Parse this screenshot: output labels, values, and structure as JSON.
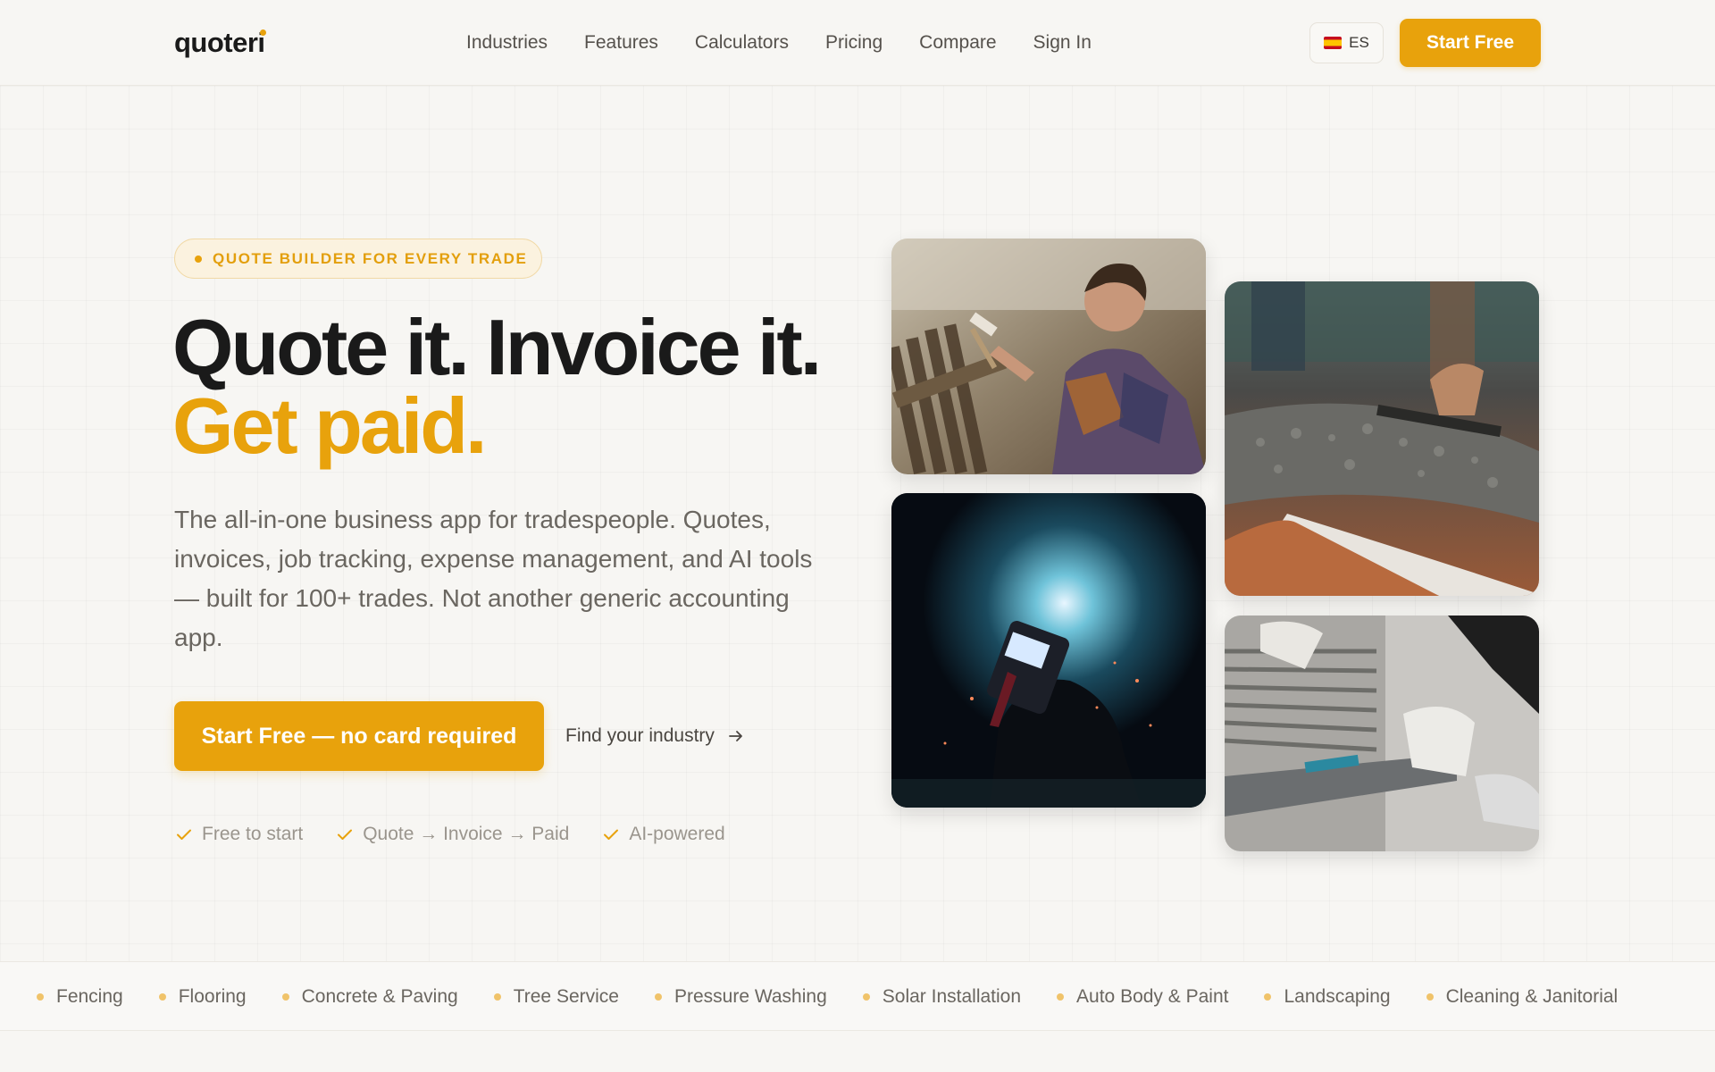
{
  "brand": {
    "name": "quoteri",
    "accent": "#e8a20c"
  },
  "nav": {
    "links": [
      "Industries",
      "Features",
      "Calculators",
      "Pricing",
      "Compare",
      "Sign In"
    ],
    "language": "ES",
    "cta": "Start Free"
  },
  "hero": {
    "badge": "QUOTE BUILDER FOR EVERY TRADE",
    "headline_line1": "Quote it. Invoice it.",
    "headline_line2": "Get paid.",
    "description": "The all-in-one business app for tradespeople. Quotes, invoices, job tracking, expense management, and AI tools — built for 100+ trades. Not another generic accounting app.",
    "primary_cta": "Start Free — no card required",
    "secondary_cta": "Find your industry",
    "checks": [
      "Free to start",
      "Quote → Invoice → Paid",
      "AI-powered"
    ]
  },
  "photos": [
    {
      "name": "carpenter-photo",
      "icon": "hammer-fence"
    },
    {
      "name": "concrete-photo",
      "icon": "concrete-screed"
    },
    {
      "name": "welder-photo",
      "icon": "welding-sparks"
    },
    {
      "name": "tiling-photo",
      "icon": "tile-floor"
    }
  ],
  "trades": [
    "Fencing",
    "Flooring",
    "Concrete & Paving",
    "Tree Service",
    "Pressure Washing",
    "Solar Installation",
    "Auto Body & Paint",
    "Landscaping",
    "Cleaning & Janitorial"
  ]
}
